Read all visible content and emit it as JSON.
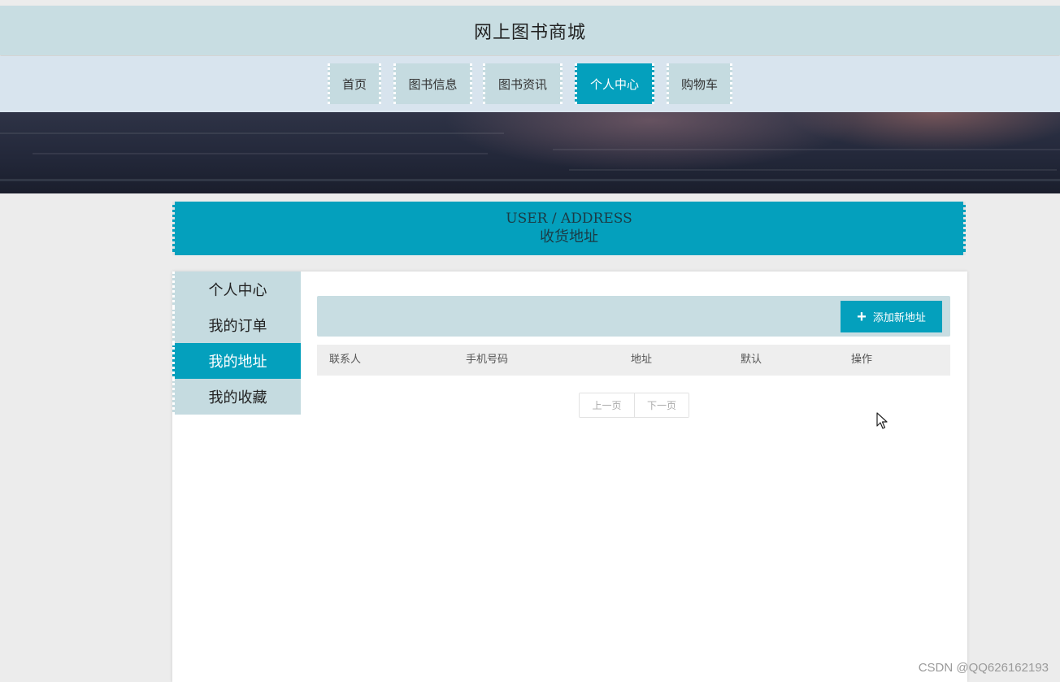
{
  "header": {
    "title": "网上图书商城"
  },
  "nav": {
    "items": [
      {
        "label": "首页"
      },
      {
        "label": "图书信息"
      },
      {
        "label": "图书资讯"
      },
      {
        "label": "个人中心"
      },
      {
        "label": "购物车"
      }
    ],
    "active_index": 3
  },
  "section": {
    "title_en": "USER / ADDRESS",
    "title_zh": "收货地址"
  },
  "sidebar": {
    "items": [
      {
        "label": "个人中心"
      },
      {
        "label": "我的订单"
      },
      {
        "label": "我的地址"
      },
      {
        "label": "我的收藏"
      }
    ],
    "active_index": 2
  },
  "toolbar": {
    "add_label": "添加新地址",
    "add_icon": "plus-icon"
  },
  "table": {
    "columns": [
      "联系人",
      "手机号码",
      "地址",
      "默认",
      "操作"
    ],
    "rows": []
  },
  "pagination": {
    "prev_label": "上一页",
    "next_label": "下一页"
  },
  "watermark": "CSDN @QQ626162193",
  "colors": {
    "accent": "#04a0bd",
    "header_bg": "#c8dde2",
    "nav_bg": "#d8e4ee",
    "item_bg": "#c5dbe0"
  }
}
